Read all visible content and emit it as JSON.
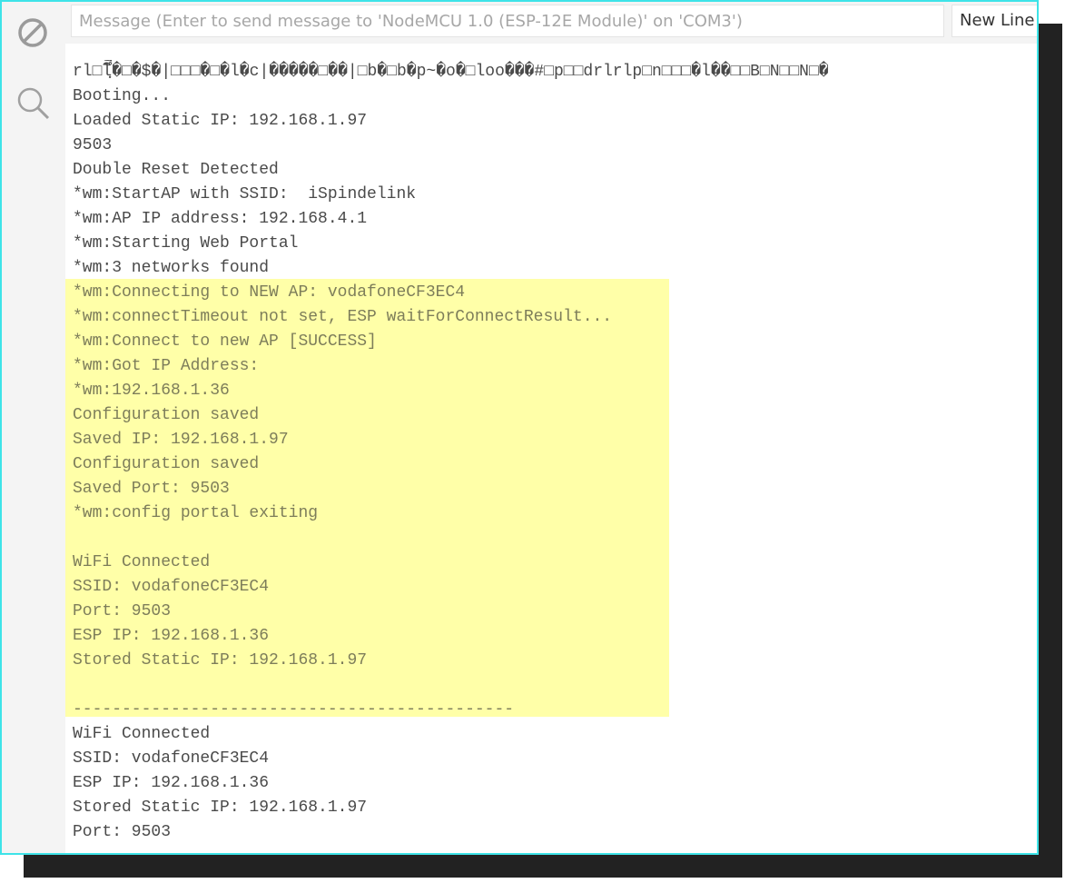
{
  "toolbar": {
    "message_placeholder": "Message (Enter to send message to 'NodeMCU 1.0 (ESP-12E Module)' on 'COM3')",
    "line_ending": "New Line"
  },
  "output": {
    "lines": [
      "rl□lฺึื�□�$�|□□□�□�l�c|�����□��|□b�□b�p~�o�□loo���#□p□□drlrlp□n□□□�l��□□B□N□□N□�",
      "Booting...",
      "Loaded Static IP: 192.168.1.97",
      "9503",
      "Double Reset Detected",
      "*wm:StartAP with SSID:  iSpindelink",
      "*wm:AP IP address: 192.168.4.1",
      "*wm:Starting Web Portal",
      "*wm:3 networks found",
      "*wm:Connecting to NEW AP: vodafoneCF3EC4",
      "*wm:connectTimeout not set, ESP waitForConnectResult...",
      "*wm:Connect to new AP [SUCCESS]",
      "*wm:Got IP Address:",
      "*wm:192.168.1.36",
      "Configuration saved",
      "Saved IP: 192.168.1.97",
      "Configuration saved",
      "Saved Port: 9503",
      "*wm:config portal exiting",
      "",
      "WiFi Connected",
      "SSID: vodafoneCF3EC4",
      "Port: 9503",
      "ESP IP: 192.168.1.36",
      "Stored Static IP: 192.168.1.97",
      "",
      "---------------------------------------------",
      "WiFi Connected",
      "SSID: vodafoneCF3EC4",
      "ESP IP: 192.168.1.36",
      "Stored Static IP: 192.168.1.97",
      "Port: 9503"
    ]
  },
  "icons": {
    "clear": "clear-output-icon",
    "search": "search-icon"
  },
  "colors": {
    "highlight": "#ffffa8",
    "border": "#3ee3e8",
    "sidebar": "#f4f4f4",
    "text": "#4a4a4a"
  }
}
